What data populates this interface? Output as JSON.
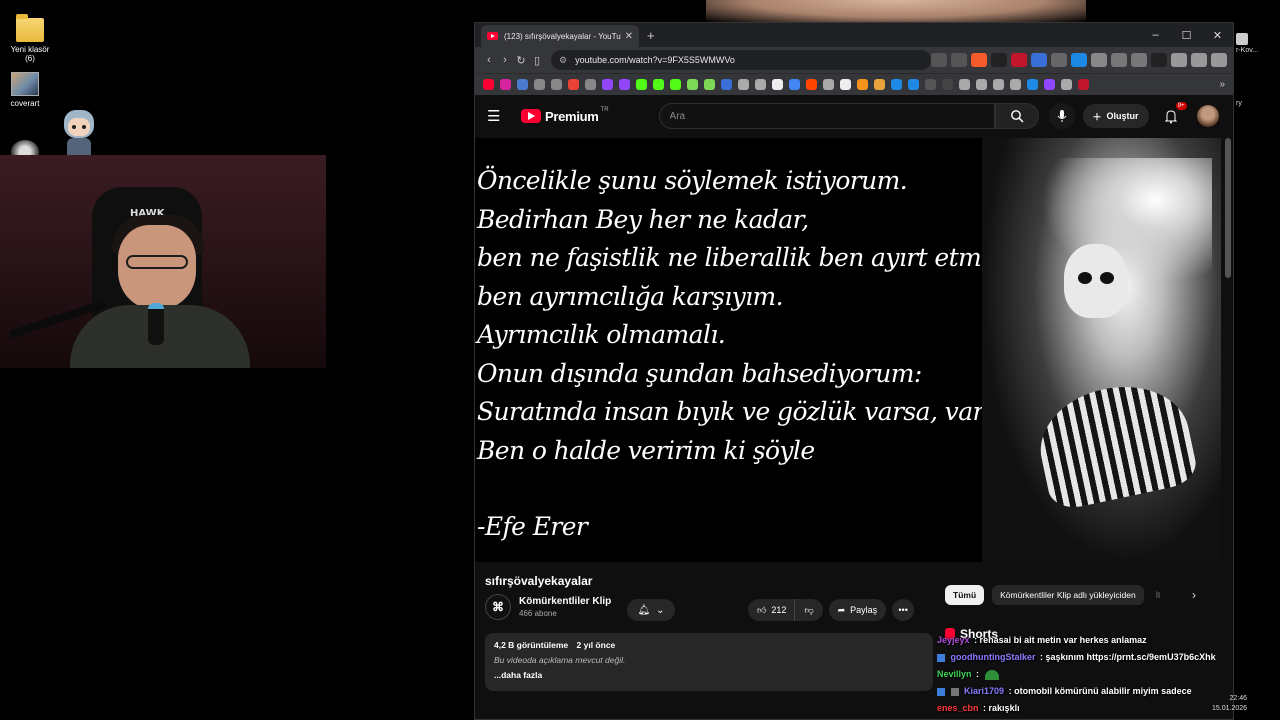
{
  "desktop": {
    "icons": [
      {
        "label": "Yeni klasör",
        "sub": "(6)"
      },
      {
        "label": "coverart",
        "sub": ""
      }
    ],
    "right_edge_label": "r-Kov...",
    "right_edge_label2": "ry",
    "clock_time": "22:46",
    "clock_date": "15.01.2026"
  },
  "webcam": {
    "chair_logo": "HAWK"
  },
  "browser": {
    "tab_title": "(123) sıfırşövalyekayalar - YouTube",
    "url": "youtube.com/watch?v=9FX5S5WMWVo",
    "win_controls": [
      "–",
      "☐",
      "✕"
    ]
  },
  "youtube": {
    "logo_word": "Premium",
    "logo_country": "TR",
    "search_placeholder": "Ara",
    "create_label": "Oluştur",
    "notif_badge": "9+",
    "video": {
      "quote_lines": [
        "Öncelikle şunu söylemek istiyorum.",
        "Bedirhan Bey her ne kadar,",
        "ben ne faşistlik ne liberallik ben ayırt etmem",
        "ben ayrımcılığa karşıyım.",
        "Ayrımcılık olmamalı.",
        "Onun dışında şundan bahsediyorum:",
        "Suratında insan bıyık ve gözlük varsa, var mı ?",
        "Ben o halde veririm ki şöyle"
      ],
      "author": "-Efe Erer"
    },
    "title": "sıfırşövalyekayalar",
    "channel_name": "Kömürkentliler Klip",
    "channel_subs": "466 abone",
    "likes": "212",
    "share_label": "Paylaş",
    "views": "4,2 B görüntüleme",
    "age": "2 yıl önce",
    "no_desc": "Bu videoda açıklama mevcut değil.",
    "more_label": "...daha fazla",
    "chips": [
      "Tümü",
      "Kömürkentliler Klip adlı yükleyiciden",
      "İl"
    ],
    "shorts_label": "Shorts"
  },
  "chat": [
    {
      "user": "Jeyjeyx",
      "color": "#b04bd8",
      "text": ": renasai bi ait metin var herkes anlamaz"
    },
    {
      "user": "goodhuntingStalker",
      "color": "#8a7cff",
      "text": ": şaşkınım https://prnt.sc/9emU37b6cXhk"
    },
    {
      "user": "Nevillyn",
      "color": "#3fd25a",
      "text": ":"
    },
    {
      "user": "Kiari1709",
      "color": "#8a7cff",
      "text": ": otomobil kömürünü alabilir miyim sadece"
    },
    {
      "user": "enes_cbn",
      "color": "#ff3b3b",
      "text": ": rakışklı"
    }
  ]
}
